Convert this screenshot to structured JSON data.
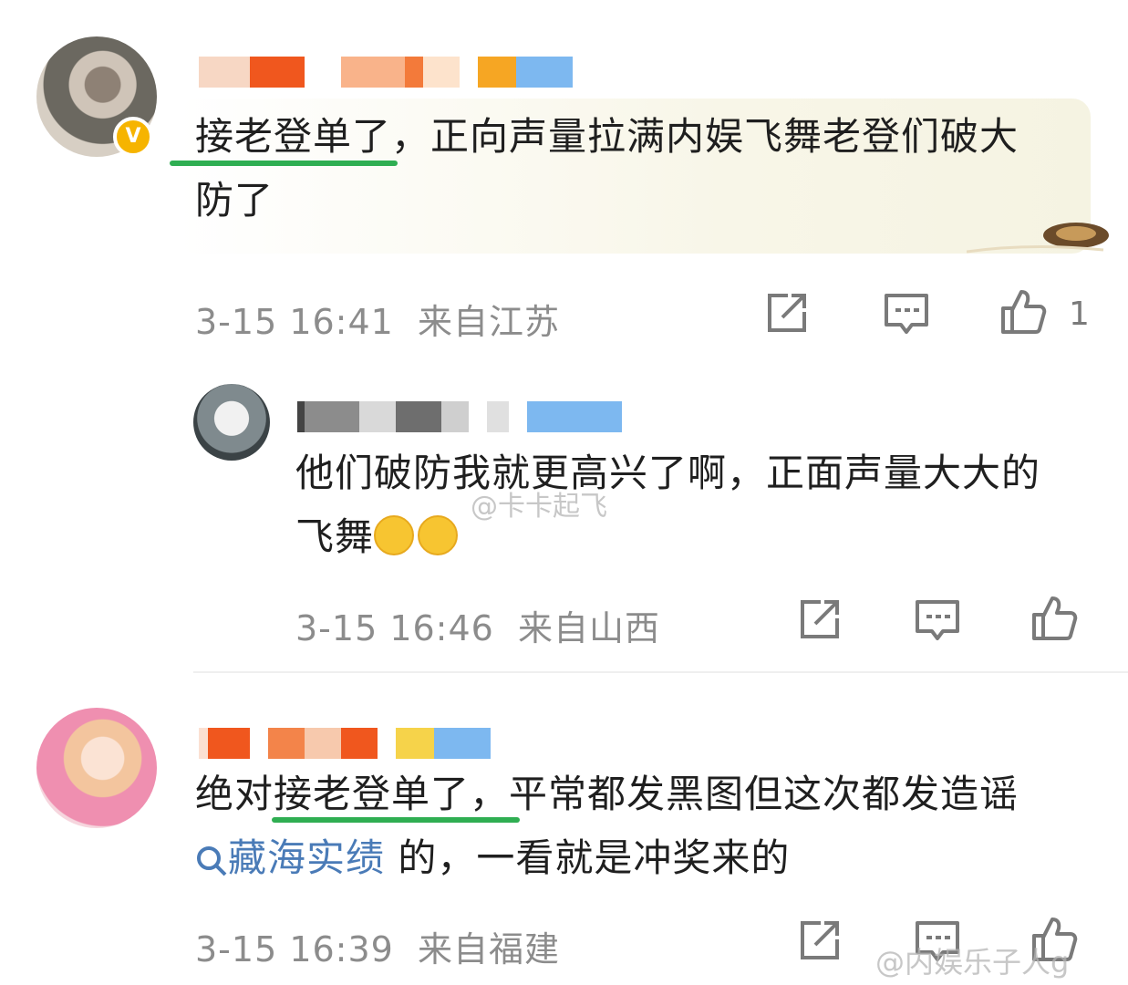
{
  "comments": [
    {
      "text_line1_underlined": "接老登单了",
      "text_line1_rest": "，正向声量拉满内娱飞舞老登们破大",
      "text_line2": "防了",
      "timestamp": "3-15 16:41",
      "location": "来自江苏",
      "like_count": "1"
    },
    {
      "text_line1": "他们破防我就更高兴了啊，正面声量大大的",
      "text_line2": "飞舞",
      "timestamp": "3-15 16:46",
      "location": "来自山西"
    },
    {
      "text_line1_prefix": "绝对",
      "text_line1_underlined": "接老登单了，",
      "text_line1_rest": "平常都发黑图但这次都发造谣",
      "search_link": "藏海实绩",
      "text_line2_rest": " 的，一看就是冲奖来的",
      "timestamp": "3-15 16:39",
      "location": "来自福建"
    }
  ],
  "verified_badge": "V",
  "watermarks": {
    "center": "@卡卡起飞",
    "bottom_right": "@内娱乐子人g"
  },
  "colors": {
    "underline": "#2fae52",
    "meta": "#8c8c8c",
    "link": "#4a7bb7",
    "badge": "#f6b400"
  }
}
